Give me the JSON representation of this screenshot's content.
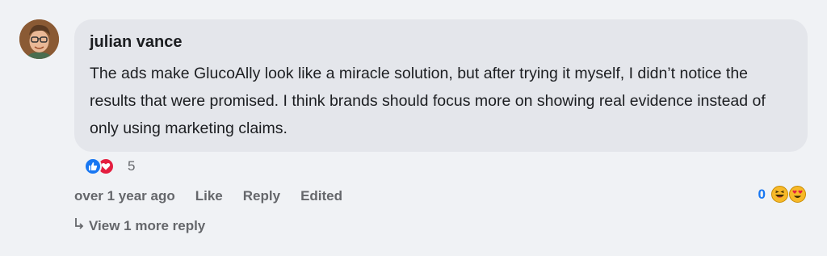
{
  "comment": {
    "author": "julian vance",
    "text": "The ads make GlucoAlly look like a miracle solution, but after trying it myself, I didn’t notice the results that were promised. I think brands should focus more on showing real evidence instead of only using marketing claims.",
    "reaction_count": "5",
    "reaction_icons": [
      "like-icon",
      "love-icon"
    ],
    "timestamp": "over 1 year ago",
    "actions": {
      "like": "Like",
      "reply": "Reply",
      "edited": "Edited"
    },
    "secondary_reactions": {
      "count": "0",
      "icons": [
        "laughing-emoji-icon",
        "heart-eyes-emoji-icon"
      ]
    },
    "view_more_replies": "View 1 more reply"
  },
  "colors": {
    "background": "#f0f2f5",
    "bubble": "#e4e6eb",
    "accent": "#1877f2",
    "muted_text": "#65676b"
  }
}
